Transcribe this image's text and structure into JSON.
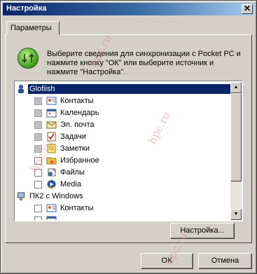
{
  "window": {
    "title": "Настройка",
    "close_symbol": "✕"
  },
  "tab": {
    "label": "Параметры"
  },
  "instructions": "Выберите сведения для синхронизации с Pocket PC и нажмите кнопку \"ОК\" или выберите источник и нажмите \"Настройка\".",
  "list": {
    "groups": [
      {
        "label": "Glofiish",
        "selected": true
      },
      {
        "label": "ПК2 с Windows",
        "selected": false
      }
    ],
    "items_glofiish": [
      {
        "label": "Контакты",
        "icon": "contacts-icon",
        "checkbox": "disabled"
      },
      {
        "label": "Календарь",
        "icon": "calendar-icon",
        "checkbox": "disabled"
      },
      {
        "label": "Эл. почта",
        "icon": "mail-icon",
        "checkbox": "disabled"
      },
      {
        "label": "Задачи",
        "icon": "tasks-icon",
        "checkbox": "disabled"
      },
      {
        "label": "Заметки",
        "icon": "notes-icon",
        "checkbox": "disabled"
      },
      {
        "label": "Избранное",
        "icon": "favorites-icon",
        "checkbox": "unchecked"
      },
      {
        "label": "Файлы",
        "icon": "files-icon",
        "checkbox": "unchecked"
      },
      {
        "label": "Media",
        "icon": "media-icon",
        "checkbox": "unchecked"
      }
    ],
    "items_pc2": [
      {
        "label": "Контакты",
        "icon": "contacts-icon",
        "checkbox": "unchecked"
      },
      {
        "label": "",
        "icon": "calendar-icon",
        "checkbox": "unchecked"
      }
    ]
  },
  "buttons": {
    "settings": "Настройка...",
    "ok": "OK",
    "cancel": "Отмена"
  },
  "watermark": "hpc.ru",
  "colors": {
    "title_start": "#0a246a",
    "title_end": "#a6caf0",
    "selection": "#0a246a",
    "dialog": "#d4d0c8"
  }
}
